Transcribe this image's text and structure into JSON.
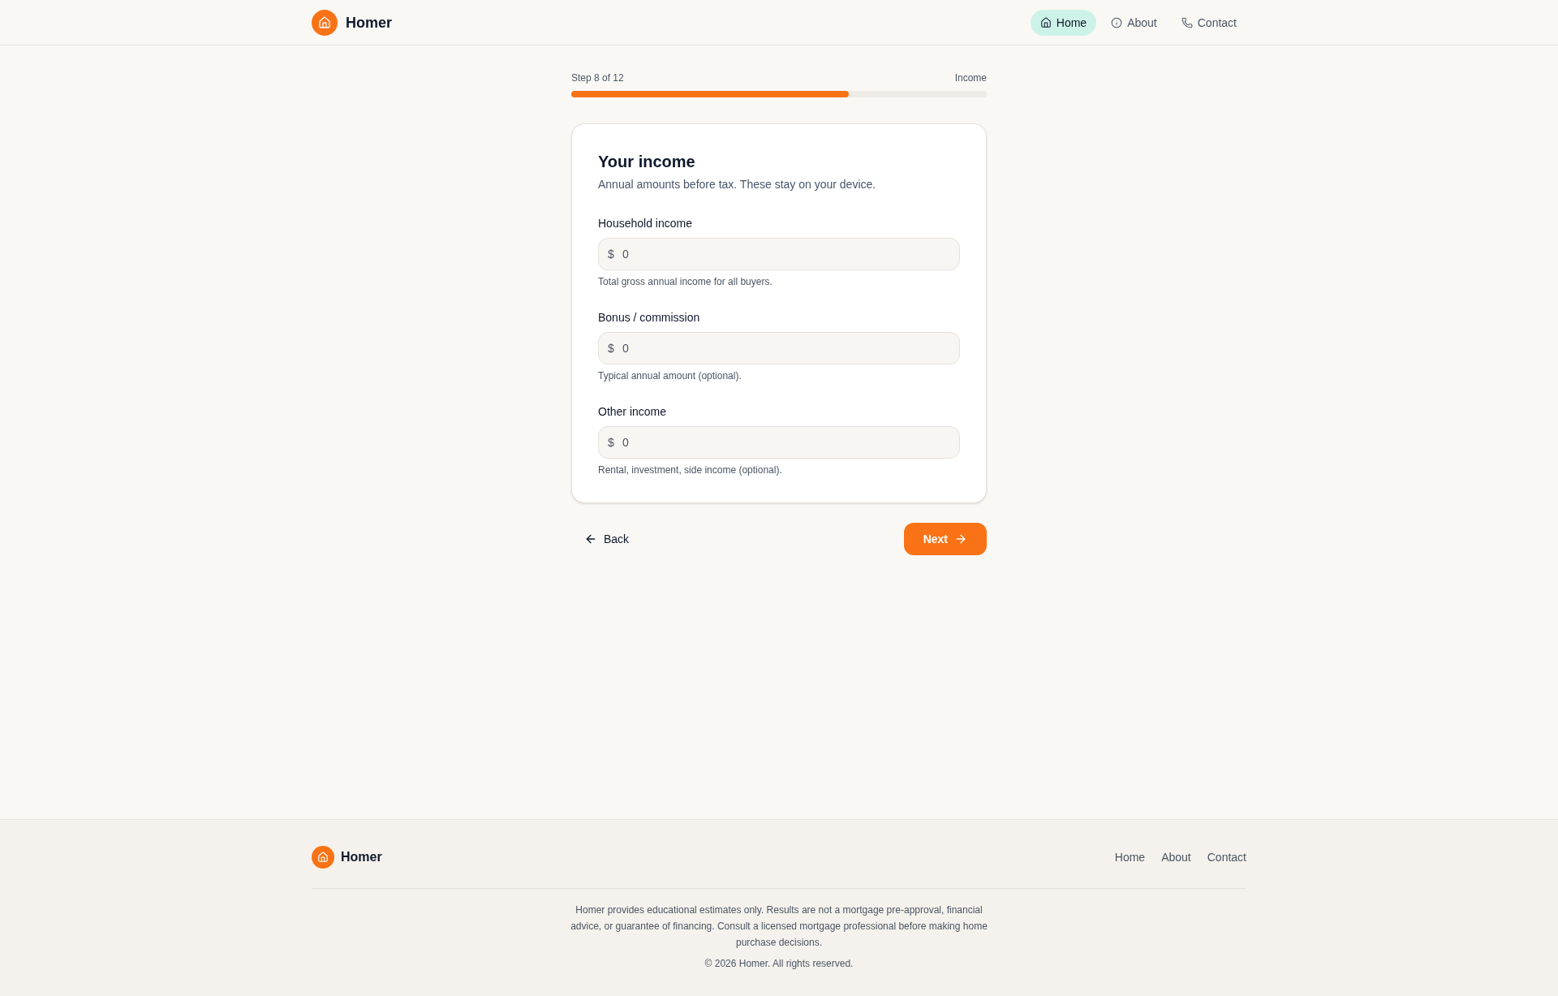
{
  "header": {
    "brand": "Homer",
    "nav": [
      {
        "label": "Home",
        "selected": true
      },
      {
        "label": "About",
        "selected": false
      },
      {
        "label": "Contact",
        "selected": false
      }
    ]
  },
  "progress": {
    "step": "Step 8 of 12",
    "section": "Income",
    "level": 0.667
  },
  "card": {
    "title": "Your income",
    "subtitle": "Annual amounts before tax. These stay on your device.",
    "fields": [
      {
        "label": "Household income",
        "prefix": "$",
        "placeholder": "0",
        "help": "Total gross annual income for all buyers."
      },
      {
        "label": "Bonus / commission",
        "prefix": "$",
        "placeholder": "0",
        "help": "Typical annual amount (optional)."
      },
      {
        "label": "Other income",
        "prefix": "$",
        "placeholder": "0",
        "help": "Rental, investment, side income (optional)."
      }
    ]
  },
  "actions": {
    "back": "Back",
    "next": "Next"
  },
  "footer": {
    "brand": "Homer",
    "links": [
      "Home",
      "About",
      "Contact"
    ],
    "disclaimer": "Homer provides educational estimates only. Results are not a mortgage pre-approval, financial advice, or guarantee of financing. Consult a licensed mortgage professional before making home purchase decisions.",
    "copyright": "© 2026 Homer. All rights reserved."
  }
}
